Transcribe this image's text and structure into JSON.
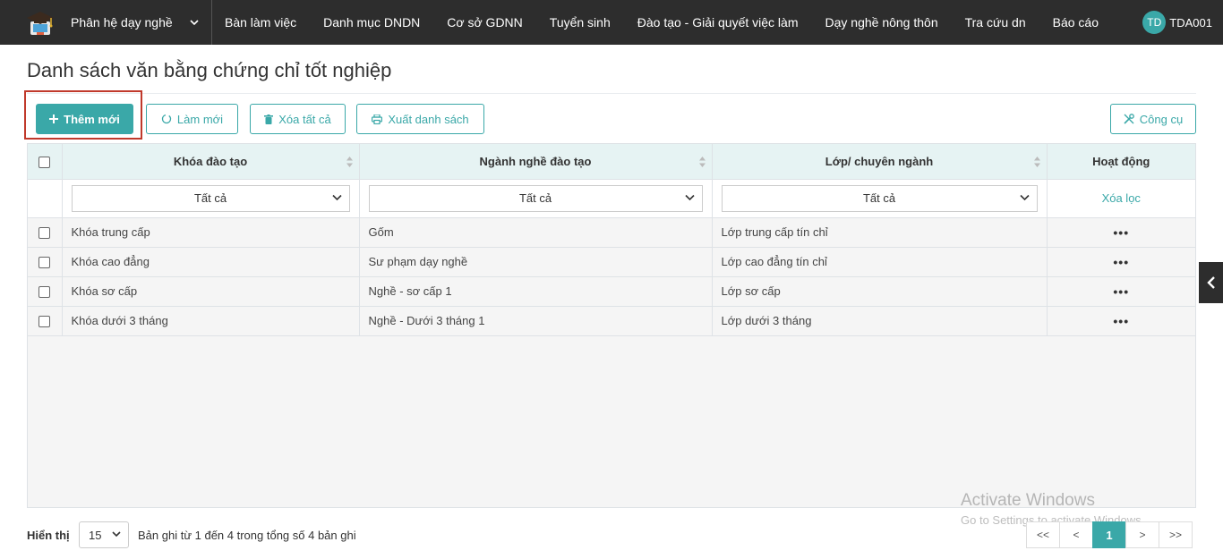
{
  "navbar": {
    "module_title": "Phân hệ dạy nghề",
    "items": [
      "Bàn làm việc",
      "Danh mục DNDN",
      "Cơ sở GDNN",
      "Tuyển sinh",
      "Đào tạo - Giải quyết việc làm",
      "Dạy nghề nông thôn",
      "Tra cứu dn",
      "Báo cáo"
    ],
    "user_initials": "TD",
    "username": "TDA001"
  },
  "page": {
    "title": "Danh sách văn bằng chứng chỉ tốt nghiệp"
  },
  "toolbar": {
    "add_label": "Thêm mới",
    "refresh_label": "Làm mới",
    "delete_all_label": "Xóa tất cả",
    "export_label": "Xuất danh sách",
    "tools_label": "Công cụ"
  },
  "table": {
    "headers": {
      "khoa": "Khóa đào tạo",
      "nganh": "Ngành nghề đào tạo",
      "lop": "Lớp/ chuyên ngành",
      "actions": "Hoạt động"
    },
    "filters": {
      "khoa": "Tất cả",
      "nganh": "Tất cả",
      "lop": "Tất cả",
      "clear": "Xóa lọc"
    },
    "rows": [
      {
        "khoa": "Khóa trung cấp",
        "nganh": "Gốm",
        "lop": "Lớp trung cấp tín chỉ",
        "actions": "•••"
      },
      {
        "khoa": "Khóa cao đẳng",
        "nganh": "Sư phạm dạy nghề",
        "lop": "Lớp cao đẳng tín chỉ",
        "actions": "•••"
      },
      {
        "khoa": "Khóa sơ cấp",
        "nganh": "Nghề - sơ cấp 1",
        "lop": "Lớp sơ cấp",
        "actions": "•••"
      },
      {
        "khoa": "Khóa dưới 3 tháng",
        "nganh": "Nghề - Dưới 3 tháng 1",
        "lop": "Lớp dưới 3 tháng",
        "actions": "•••"
      }
    ]
  },
  "footer": {
    "show_label": "Hiển thị",
    "page_size": "15",
    "record_info": "Bản ghi từ 1 đến 4 trong tổng số 4 bản ghi",
    "pager": [
      "<<",
      "<",
      "1",
      ">",
      ">>"
    ],
    "current_page": "1"
  },
  "watermark": {
    "title": "Activate Windows",
    "subtitle": "Go to Settings to activate Windows."
  },
  "colors": {
    "accent": "#3aa8a8",
    "navbar": "#2d2d2d",
    "highlight": "#c0392b"
  },
  "icons": {
    "logo": "graduation-cap-logo-icon",
    "module_dropdown": "chevron-down-icon",
    "add": "plus-icon",
    "refresh": "refresh-icon",
    "delete": "trash-icon",
    "export": "printer-icon",
    "tools": "tools-icon",
    "side_tab": "chevron-left-icon"
  }
}
